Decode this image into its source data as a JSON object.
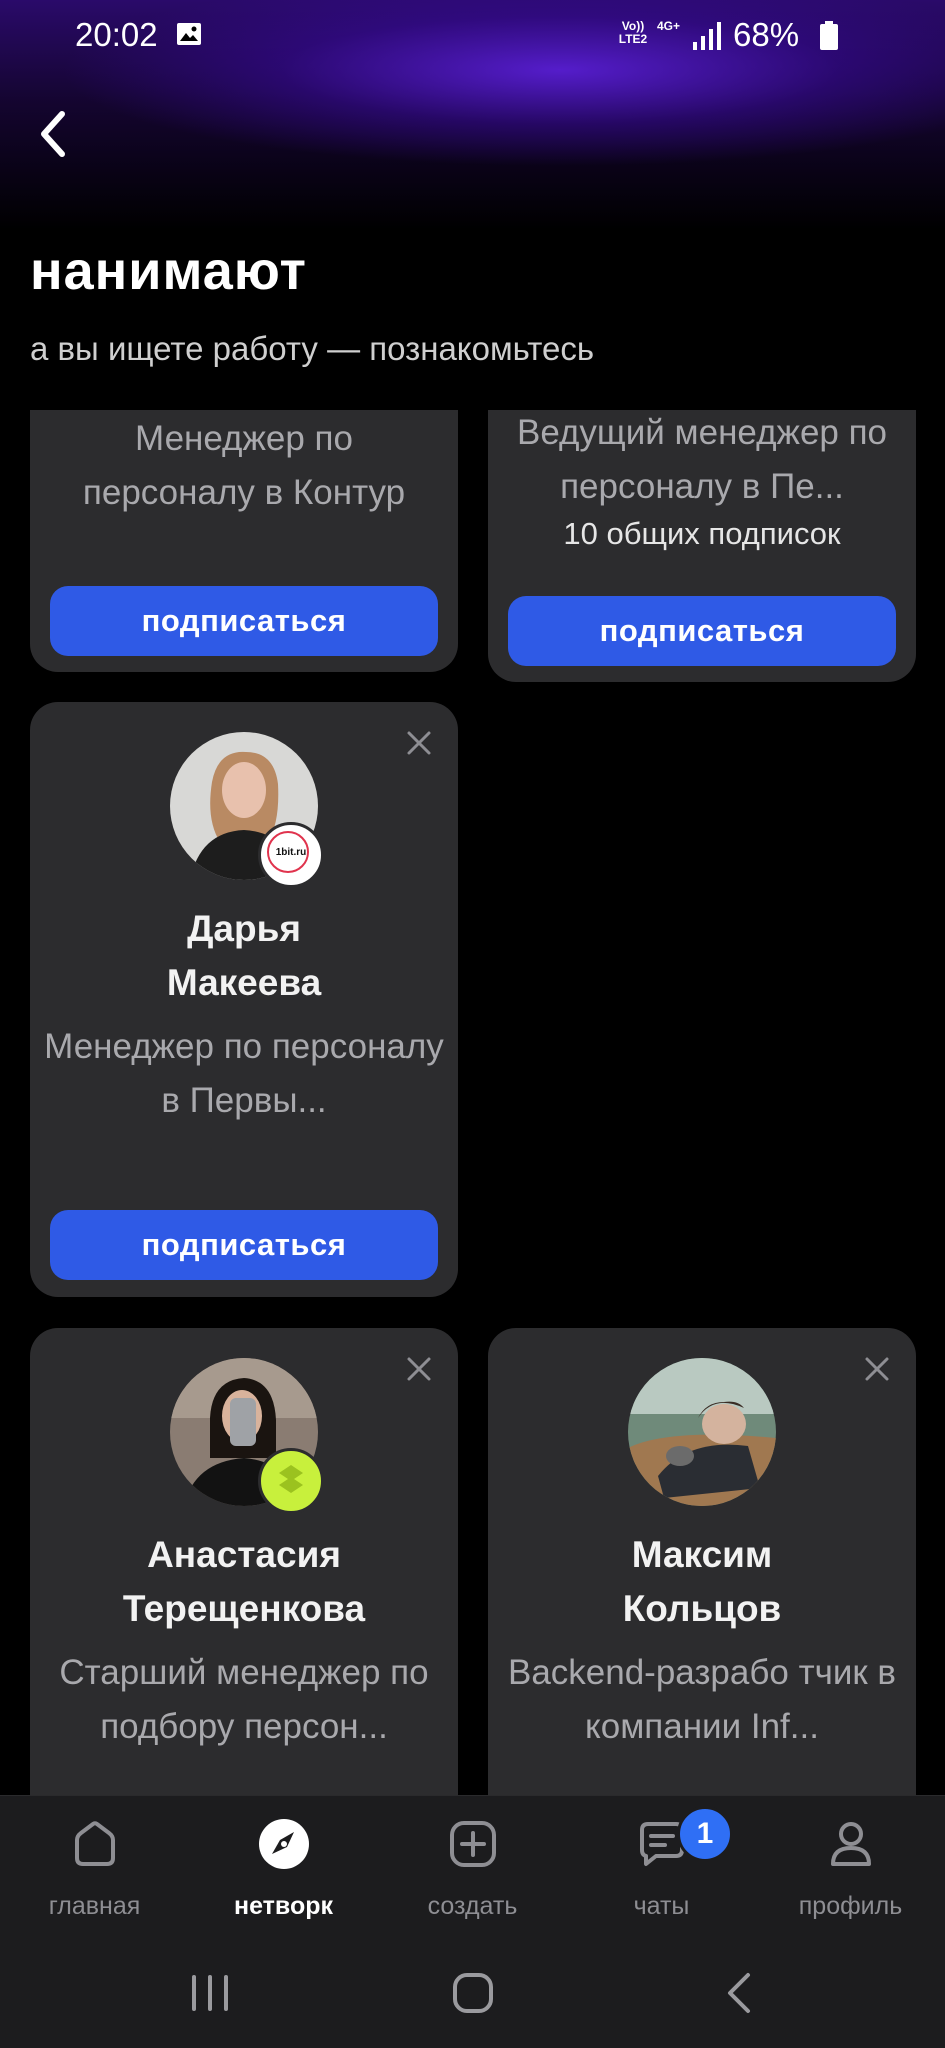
{
  "status_bar": {
    "time": "20:02",
    "lte_label": "Vo)) LTE2",
    "net_label": "4G+",
    "battery": "68%"
  },
  "header": {
    "title": "нанимают",
    "subtitle": "а вы ищете работу — познакомьтесь"
  },
  "cards": {
    "top_left": {
      "role": "Менеджер по персоналу в Контур",
      "button": "подписаться"
    },
    "top_right": {
      "role": "Ведущий менеджер по персоналу в Пе...",
      "mutual": "10 общих подписок",
      "button": "подписаться"
    },
    "daria": {
      "name": "Дарья Макеева",
      "role": "Менеджер по персоналу в Первы...",
      "badge_text": "1bit.ru",
      "button": "подписаться"
    },
    "anastasia": {
      "name": "Анастасия Терещенкова",
      "role": "Старший менеджер по подбору персон..."
    },
    "maksim": {
      "name": "Максим Кольцов",
      "role": "Backend-разрабо тчик в компании Inf..."
    }
  },
  "tabbar": {
    "items": [
      {
        "label": "главная",
        "icon": "home-icon"
      },
      {
        "label": "нетворк",
        "icon": "compass-icon",
        "active": true
      },
      {
        "label": "создать",
        "icon": "plus-square-icon"
      },
      {
        "label": "чаты",
        "icon": "chat-icon",
        "badge": "1"
      },
      {
        "label": "профиль",
        "icon": "person-icon"
      }
    ]
  },
  "colors": {
    "accent": "#2f5ae6",
    "card_bg": "#2c2c2e",
    "badge": "#2f6ff5"
  }
}
